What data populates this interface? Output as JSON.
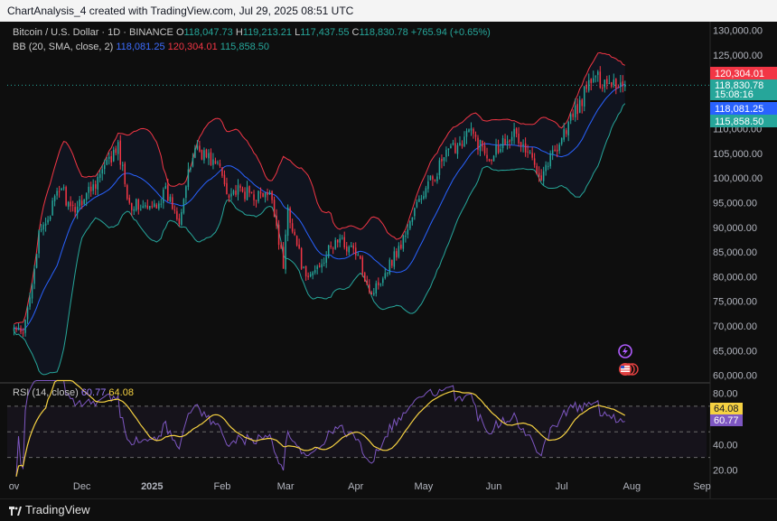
{
  "header": {
    "caption": "ChartAnalysis_4 created with TradingView.com, Jul 29, 2025 08:51 UTC"
  },
  "legend": {
    "symbol": "Bitcoin / U.S. Dollar · 1D · BINANCE",
    "o_label": "O",
    "o_value": "118,047.73",
    "h_label": "H",
    "h_value": "119,213.21",
    "l_label": "L",
    "l_value": "117,437.55",
    "c_label": "C",
    "c_value": "118,830.78",
    "change": "+765.94 (+0.65%)",
    "bb_label": "BB (20, SMA, close, 2)",
    "bb_basis": "118,081.25",
    "bb_upper": "120,304.01",
    "bb_lower": "115,858.50"
  },
  "rsi_legend": {
    "label": "RSI (14, close)",
    "rsi": "60.77",
    "rsi_ma": "64.08"
  },
  "footer": {
    "brand": "TradingView"
  },
  "colors": {
    "up": "#26a69a",
    "down": "#f23645",
    "basis": "#2962ff",
    "upper": "#f23645",
    "lower": "#26a69a",
    "rsi": "#7e57c2",
    "rsi_ma": "#f5d142"
  },
  "chart_data": {
    "type": "candlestick",
    "title": "Bitcoin / U.S. Dollar · 1D · BINANCE",
    "price_axis": {
      "ticks": [
        "130,000.00",
        "125,000.00",
        "110,000.00",
        "105,000.00",
        "100,000.00",
        "95,000.00",
        "90,000.00",
        "85,000.00",
        "80,000.00",
        "75,000.00",
        "70,000.00",
        "65,000.00",
        "60,000.00"
      ],
      "ylim": [
        59000,
        131000
      ]
    },
    "price_labels": [
      {
        "name": "upper",
        "text": "120,304.01",
        "value": 120304,
        "color": "#f23645"
      },
      {
        "name": "close",
        "text": "118,830.78",
        "value": 118830,
        "color": "#26a69a"
      },
      {
        "name": "countdown",
        "text": "15:08:16",
        "value": 118830,
        "color": "#26a69a"
      },
      {
        "name": "basis",
        "text": "118,081.25",
        "value": 118081,
        "color": "#2962ff"
      },
      {
        "name": "lower",
        "text": "115,858.50",
        "value": 115858,
        "color": "#26a69a"
      }
    ],
    "x_axis": {
      "labels": [
        "ov",
        "Dec",
        "2025",
        "Feb",
        "Mar",
        "Apr",
        "May",
        "Jun",
        "Jul",
        "Aug",
        "Sep"
      ],
      "bold": [
        "2025"
      ]
    },
    "close_anchors": [
      {
        "date": "2024-11-01",
        "close": 69500
      },
      {
        "date": "2024-11-05",
        "close": 68000
      },
      {
        "date": "2024-11-12",
        "close": 88000
      },
      {
        "date": "2024-11-22",
        "close": 98500
      },
      {
        "date": "2024-11-26",
        "close": 93000
      },
      {
        "date": "2024-12-05",
        "close": 98000
      },
      {
        "date": "2024-12-17",
        "close": 106000
      },
      {
        "date": "2024-12-22",
        "close": 95000
      },
      {
        "date": "2024-12-31",
        "close": 93500
      },
      {
        "date": "2025-01-07",
        "close": 97000
      },
      {
        "date": "2025-01-13",
        "close": 92000
      },
      {
        "date": "2025-01-20",
        "close": 106500
      },
      {
        "date": "2025-01-31",
        "close": 102000
      },
      {
        "date": "2025-02-03",
        "close": 97500
      },
      {
        "date": "2025-02-23",
        "close": 96000
      },
      {
        "date": "2025-02-28",
        "close": 82000
      },
      {
        "date": "2025-03-02",
        "close": 94000
      },
      {
        "date": "2025-03-10",
        "close": 79000
      },
      {
        "date": "2025-03-24",
        "close": 87500
      },
      {
        "date": "2025-04-01",
        "close": 85000
      },
      {
        "date": "2025-04-08",
        "close": 76500
      },
      {
        "date": "2025-04-21",
        "close": 86500
      },
      {
        "date": "2025-04-28",
        "close": 94500
      },
      {
        "date": "2025-05-10",
        "close": 104000
      },
      {
        "date": "2025-05-21",
        "close": 109500
      },
      {
        "date": "2025-05-30",
        "close": 104500
      },
      {
        "date": "2025-06-09",
        "close": 109500
      },
      {
        "date": "2025-06-22",
        "close": 101000
      },
      {
        "date": "2025-06-30",
        "close": 107500
      },
      {
        "date": "2025-07-10",
        "close": 116000
      },
      {
        "date": "2025-07-14",
        "close": 120000
      },
      {
        "date": "2025-07-22",
        "close": 119800
      },
      {
        "date": "2025-07-29",
        "close": 118830
      }
    ],
    "bollinger": {
      "period": 20,
      "stddev": 2,
      "basis": 118081.25,
      "upper": 120304.01,
      "lower": 115858.5
    },
    "rsi": {
      "period": 14,
      "value": 60.77,
      "ma": 64.08,
      "ticks": [
        "80.00",
        "40.00",
        "20.00"
      ],
      "ylim": [
        17,
        84
      ],
      "bands": [
        70,
        50,
        30
      ],
      "value_labels": [
        {
          "text": "64.08",
          "value": 64.08,
          "color": "#f5d142"
        },
        {
          "text": "60.77",
          "value": 60.77,
          "color": "#7e57c2"
        }
      ]
    }
  }
}
